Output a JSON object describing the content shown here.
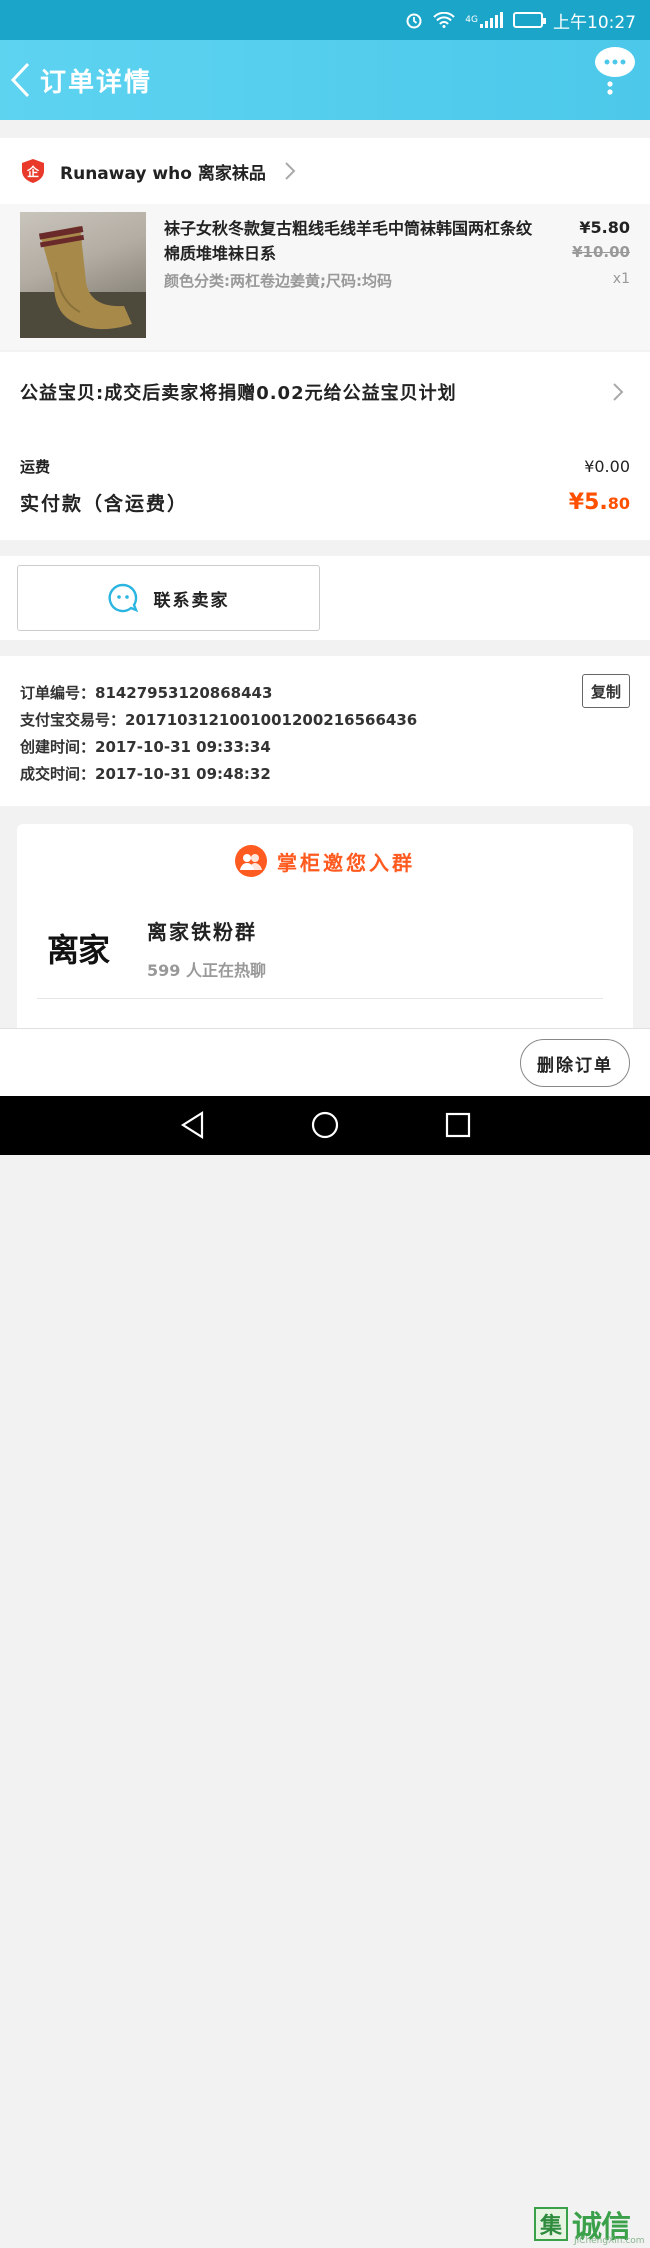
{
  "status_bar": {
    "time": "上午10:27",
    "network": "4G"
  },
  "nav": {
    "title": "订单详情"
  },
  "shop": {
    "name": "Runaway who 离家袜品"
  },
  "item": {
    "title": "袜子女秋冬款复古粗线毛线羊毛中筒袜韩国两杠条纹棉质堆堆袜日系",
    "sku": "颜色分类:两杠卷边姜黄;尺码:均码",
    "price": "¥5.80",
    "original_price": "¥10.00",
    "quantity": "x1"
  },
  "charity": {
    "text": "公益宝贝:成交后卖家将捐赠0.02元给公益宝贝计划"
  },
  "fees": {
    "shipping_label": "运费",
    "shipping_value": "¥0.00",
    "paid_label": "实付款（含运费）",
    "paid_currency": "¥",
    "paid_main": "5.",
    "paid_cents": "80"
  },
  "contact": {
    "label": "联系卖家"
  },
  "order": {
    "number": "订单编号：81427953120868443",
    "alipay": "支付宝交易号：2017103121001001200216566436",
    "created": "创建时间：2017-10-31 09:33:34",
    "completed": "成交时间：2017-10-31 09:48:32",
    "copy_label": "复制"
  },
  "group": {
    "header": "掌柜邀您入群",
    "logo_text": "离家",
    "name": "离家铁粉群",
    "count": "599 人正在热聊"
  },
  "bottom": {
    "delete_label": "删除订单"
  },
  "watermark": {
    "mark": "集",
    "text": "诚信",
    "sub": "JiChengXin.com"
  },
  "colors": {
    "accent": "#ff5000",
    "header": "#4cc8ea",
    "status_bar": "#1ba6c9"
  }
}
